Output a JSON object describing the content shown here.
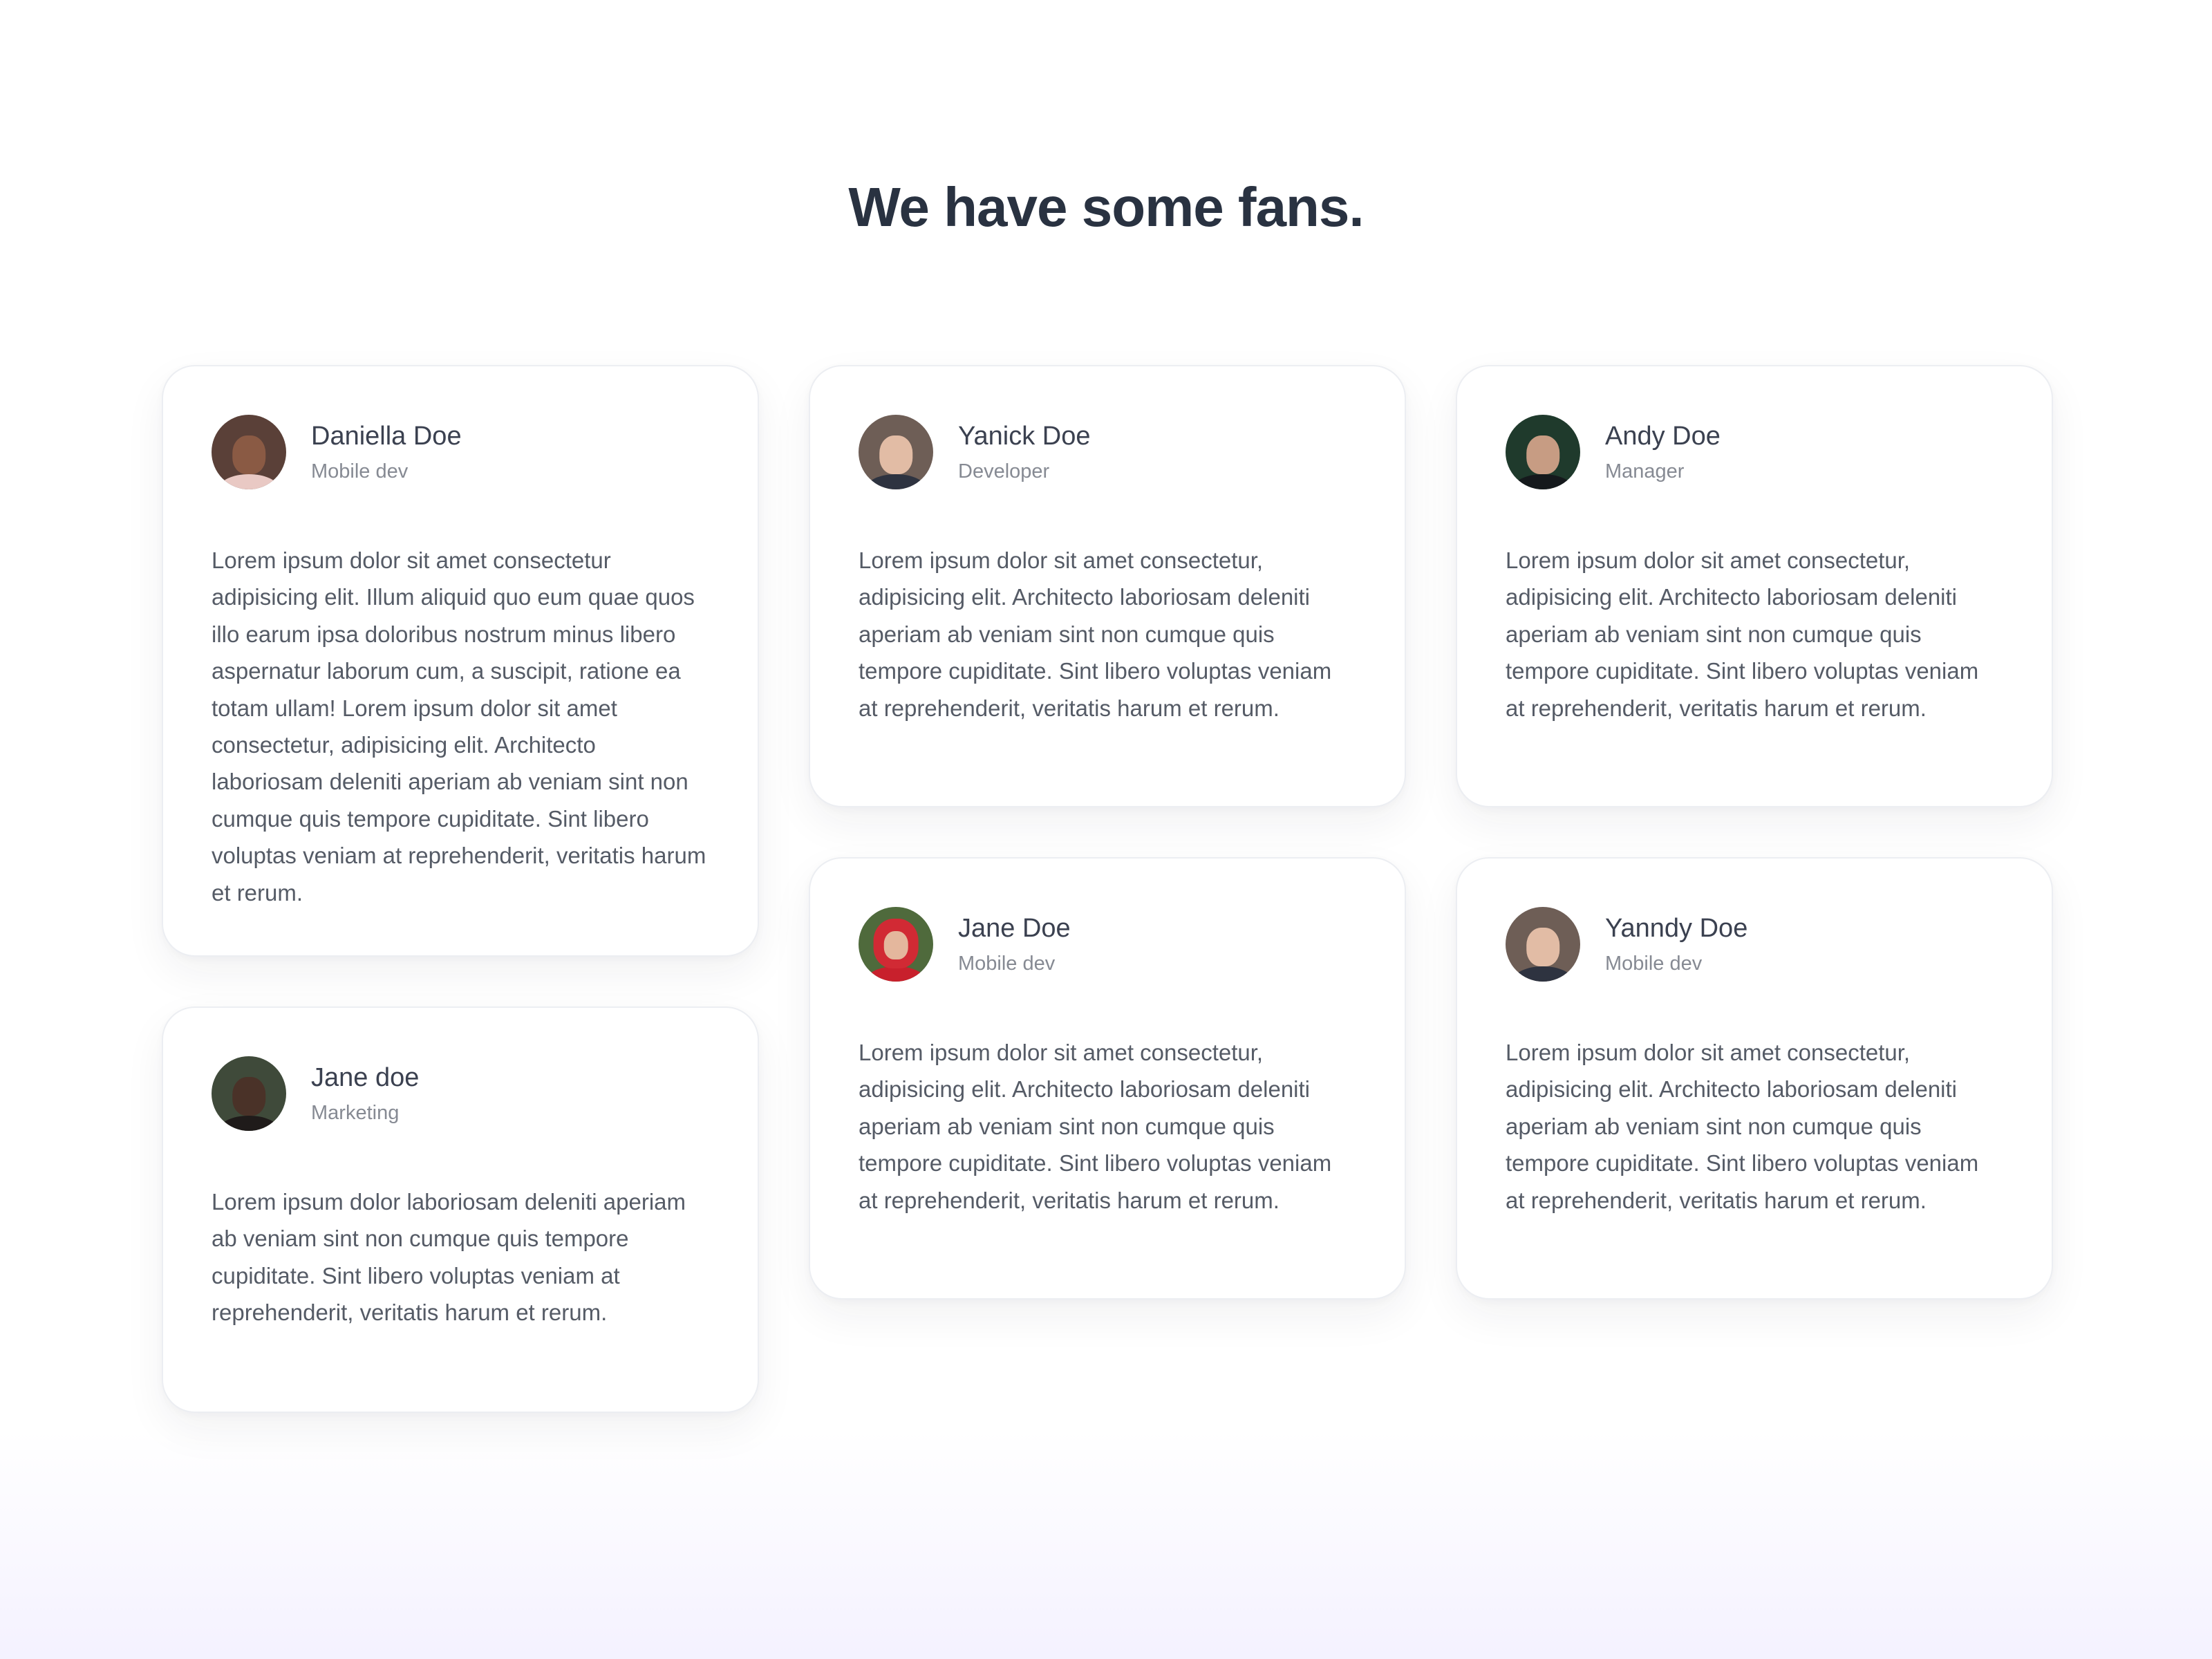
{
  "section": {
    "title": "We have some fans."
  },
  "testimonials": [
    {
      "name": "Daniella Doe",
      "role": "Mobile dev",
      "avatar_icon": "avatar-woman-curly-hair",
      "text": "Lorem ipsum dolor sit amet consectetur adipisicing elit. Illum aliquid quo eum quae quos illo earum ipsa doloribus nostrum minus libero aspernatur laborum cum, a suscipit, ratione ea totam ullam! Lorem ipsum dolor sit amet consectetur, adipisicing elit. Architecto laboriosam deleniti aperiam ab veniam sint non cumque quis tempore cupiditate. Sint libero voluptas veniam at reprehenderit, veritatis harum et rerum."
    },
    {
      "name": "Jane doe",
      "role": "Marketing",
      "avatar_icon": "avatar-woman",
      "text": "Lorem ipsum dolor laboriosam deleniti aperiam ab veniam sint non cumque quis tempore cupiditate. Sint libero voluptas veniam at reprehenderit, veritatis harum et rerum."
    },
    {
      "name": "Yanick Doe",
      "role": "Developer",
      "avatar_icon": "avatar-man",
      "text": "Lorem ipsum dolor sit amet consectetur, adipisicing elit. Architecto laboriosam deleniti aperiam ab veniam sint non cumque quis tempore cupiditate. Sint libero voluptas veniam at reprehenderit, veritatis harum et rerum."
    },
    {
      "name": "Jane Doe",
      "role": "Mobile dev",
      "avatar_icon": "avatar-woman-red-hijab",
      "text": "Lorem ipsum dolor sit amet consectetur, adipisicing elit. Architecto laboriosam deleniti aperiam ab veniam sint non cumque quis tempore cupiditate. Sint libero voluptas veniam at reprehenderit, veritatis harum et rerum."
    },
    {
      "name": "Andy Doe",
      "role": "Manager",
      "avatar_icon": "avatar-man-beard",
      "text": "Lorem ipsum dolor sit amet consectetur, adipisicing elit. Architecto laboriosam deleniti aperiam ab veniam sint non cumque quis tempore cupiditate. Sint libero voluptas veniam at reprehenderit, veritatis harum et rerum."
    },
    {
      "name": "Yanndy Doe",
      "role": "Mobile dev",
      "avatar_icon": "avatar-man",
      "text": "Lorem ipsum dolor sit amet consectetur, adipisicing elit. Architecto laboriosam deleniti aperiam ab veniam sint non cumque quis tempore cupiditate. Sint libero voluptas veniam at reprehenderit, veritatis harum et rerum."
    }
  ],
  "colors": {
    "heading": "#293241",
    "name": "#3b4150",
    "role": "#868a93",
    "text": "#555b66",
    "card_border": "#eceef2"
  }
}
